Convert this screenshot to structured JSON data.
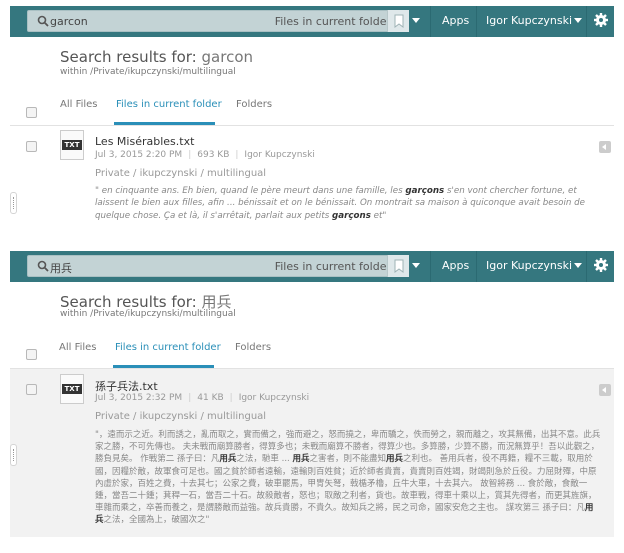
{
  "panels": [
    {
      "search": {
        "query": "garcon",
        "scope": "Files in current folder"
      },
      "nav": {
        "apps": "Apps",
        "user": "Igor Kupczynski"
      },
      "header": {
        "prefix": "Search results for:",
        "term": "garcon",
        "within": "within /Private/ikupczynski/multilingual"
      },
      "tabs": [
        "All Files",
        "Files in current folder",
        "Folders"
      ],
      "active_tab": 1,
      "result": {
        "icon_label": "TXT",
        "name": "Les Misérables.txt",
        "date": "Jul 3, 2015 2:20 PM",
        "size": "693 KB",
        "owner": "Igor Kupczynski",
        "path": "Private / ikupczynski / multilingual",
        "snippet": [
          {
            "t": "\" en cinquante ans. Eh bien, quand le père meurt dans une famille, les "
          },
          {
            "t": "garçons",
            "b": true
          },
          {
            "t": " s'en vont chercher fortune, et laissent le bien aux filles, afin ... bénissait et on le bénissait. On montrait sa maison à quiconque avait besoin de quelque chose. Ça et là, il s'arrêtait, parlait aux petits "
          },
          {
            "t": "garçons",
            "b": true
          },
          {
            "t": " et\""
          }
        ]
      }
    },
    {
      "search": {
        "query": "用兵",
        "scope": "Files in current folder"
      },
      "nav": {
        "apps": "Apps",
        "user": "Igor Kupczynski"
      },
      "header": {
        "prefix": "Search results for:",
        "term": "用兵",
        "within": "within /Private/ikupczynski/multilingual"
      },
      "tabs": [
        "All Files",
        "Files in current folder",
        "Folders"
      ],
      "active_tab": 1,
      "result": {
        "icon_label": "TXT",
        "name": "孫子兵法.txt",
        "date": "Jul 3, 2015 2:32 PM",
        "size": "41 KB",
        "owner": "Igor Kupczynski",
        "path": "Private / ikupczynski / multilingual",
        "snippet": [
          {
            "t": "\"，遠而示之近。利而誘之，亂而取之，實而備之，強而避之，怒而撓之，卑而驕之，佚而勞之，親而離之，攻其無備，出其不意。此兵家之勝，不可先傳也。 夫未戰而廟算勝者，得算多也；未戰而廟算不勝者，得算少也。多算勝，少算不勝，而況無算乎！吾以此觀之，勝負見矣。 作戰第二 孫子曰：凡"
          },
          {
            "t": "用兵",
            "b": true
          },
          {
            "t": "之法，馳車 ...  "
          },
          {
            "t": "用兵",
            "b": true
          },
          {
            "t": "之害者，則不能盡知"
          },
          {
            "t": "用兵",
            "b": true
          },
          {
            "t": "之利也。 善用兵者，役不再籍，糧不三載，取用於國，因糧於敵，故軍食可足也。國之貧於師者遠輸，遠輸則百姓貧；近於師者貴賣，貴賣則百姓竭，財竭則急於丘役。力屈財殫，中原內虛於家，百姓之費，十去其七；公家之費，破車罷馬，甲冑矢弩，戟楯矛櫓，丘牛大車，十去其六。 故智將務 ... 食於敵，食敵一鍾，當吾二十鍾；萁稈一石，當吾二十石。故殺敵者，怒也；取敵之利者，貨也。故車戰，得車十乘以上，賞其先得者，而更其旌旗，車雜而乘之，卒善而養之，是謂勝敵而益強。故兵貴勝，不貴久。故知兵之將，民之司命，國家安危之主也。 謀攻第三 孫子曰：凡"
          },
          {
            "t": "用兵",
            "b": true
          },
          {
            "t": "之法，全國為上，破國次之\""
          }
        ]
      }
    }
  ]
}
